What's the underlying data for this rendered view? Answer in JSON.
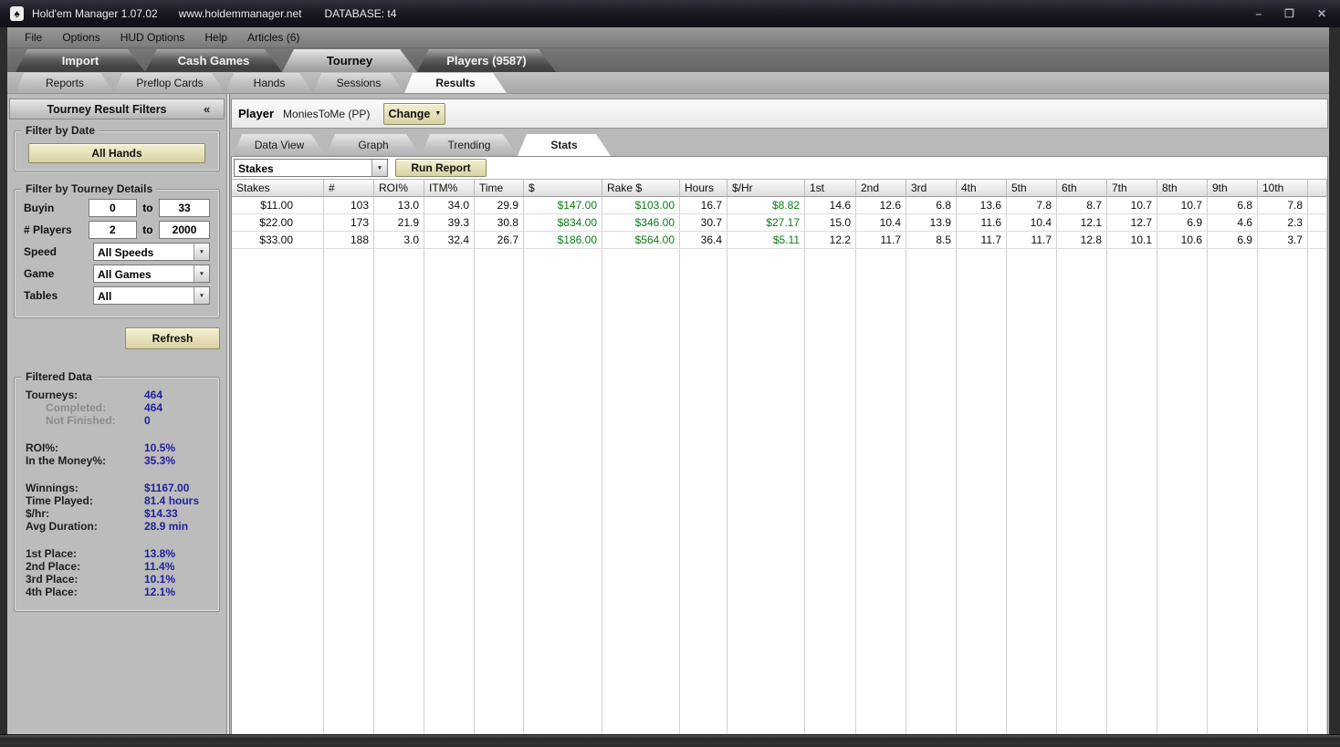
{
  "window": {
    "icon": "spade",
    "title": "Hold'em Manager 1.07.02",
    "url": "www.holdemmanager.net",
    "database": "DATABASE: t4",
    "controls": {
      "minimize": "–",
      "maximize": "❐",
      "close": "✕"
    }
  },
  "menu": {
    "items": [
      "File",
      "Options",
      "HUD Options",
      "Help",
      "Articles (6)"
    ]
  },
  "main_tabs": {
    "items": [
      {
        "label": "Import",
        "active": false
      },
      {
        "label": "Cash Games",
        "active": false
      },
      {
        "label": "Tourney",
        "active": true
      },
      {
        "label": "Players (9587)",
        "active": false
      }
    ]
  },
  "sub_tabs": {
    "items": [
      {
        "label": "Reports",
        "active": false
      },
      {
        "label": "Preflop Cards",
        "active": false
      },
      {
        "label": "Hands",
        "active": false
      },
      {
        "label": "Sessions",
        "active": false
      },
      {
        "label": "Results",
        "active": true
      }
    ]
  },
  "sidebar": {
    "title": "Tourney Result Filters",
    "collapse_icon": "«",
    "filter_by_date": {
      "label": "Filter by Date",
      "all_hands_button": "All Hands"
    },
    "filter_by_details": {
      "label": "Filter by Tourney Details",
      "buyin": {
        "label": "Buyin",
        "from": "0",
        "to_word": "to",
        "to": "33"
      },
      "players": {
        "label": "# Players",
        "from": "2",
        "to_word": "to",
        "to": "2000"
      },
      "speed": {
        "label": "Speed",
        "value": "All Speeds"
      },
      "game": {
        "label": "Game",
        "value": "All Games"
      },
      "tables": {
        "label": "Tables",
        "value": "All"
      }
    },
    "refresh_button": "Refresh",
    "filtered_data": {
      "label": "Filtered Data",
      "groups": [
        {
          "rows": [
            {
              "label": "Tourneys:",
              "value": "464"
            },
            {
              "label": "Completed:",
              "value": "464",
              "muted": true,
              "indent": true
            },
            {
              "label": "Not Finished:",
              "value": "0",
              "muted": true,
              "indent": true
            }
          ]
        },
        {
          "rows": [
            {
              "label": "ROI%:",
              "value": "10.5%"
            },
            {
              "label": "In the Money%:",
              "value": "35.3%"
            }
          ]
        },
        {
          "rows": [
            {
              "label": "Winnings:",
              "value": "$1167.00"
            },
            {
              "label": "Time Played:",
              "value": "81.4 hours"
            },
            {
              "label": "$/hr:",
              "value": "$14.33"
            },
            {
              "label": "Avg Duration:",
              "value": "28.9 min"
            }
          ]
        },
        {
          "rows": [
            {
              "label": "1st Place:",
              "value": "13.8%"
            },
            {
              "label": "2nd Place:",
              "value": "11.4%"
            },
            {
              "label": "3rd Place:",
              "value": "10.1%"
            },
            {
              "label": "4th Place:",
              "value": "12.1%"
            }
          ]
        }
      ]
    }
  },
  "player_bar": {
    "label": "Player",
    "name": "MoniesToMe (PP)",
    "change_button": "Change"
  },
  "view_tabs": {
    "items": [
      {
        "label": "Data View",
        "active": false
      },
      {
        "label": "Graph",
        "active": false
      },
      {
        "label": "Trending",
        "active": false
      },
      {
        "label": "Stats",
        "active": true
      }
    ]
  },
  "toolbar": {
    "report_select": "Stakes",
    "run_report_button": "Run Report"
  },
  "results_table": {
    "type": "table",
    "columns": [
      "Stakes",
      "#",
      "ROI%",
      "ITM%",
      "Time",
      "$",
      "Rake $",
      "Hours",
      "$/Hr",
      "1st",
      "2nd",
      "3rd",
      "4th",
      "5th",
      "6th",
      "7th",
      "8th",
      "9th",
      "10th"
    ],
    "money_columns": [
      5,
      6,
      8
    ],
    "rows": [
      [
        "$11.00",
        "103",
        "13.0",
        "34.0",
        "29.9",
        "$147.00",
        "$103.00",
        "16.7",
        "$8.82",
        "14.6",
        "12.6",
        "6.8",
        "13.6",
        "7.8",
        "8.7",
        "10.7",
        "10.7",
        "6.8",
        "7.8"
      ],
      [
        "$22.00",
        "173",
        "21.9",
        "39.3",
        "30.8",
        "$834.00",
        "$346.00",
        "30.7",
        "$27.17",
        "15.0",
        "10.4",
        "13.9",
        "11.6",
        "10.4",
        "12.1",
        "12.7",
        "6.9",
        "4.6",
        "2.3"
      ],
      [
        "$33.00",
        "188",
        "3.0",
        "32.4",
        "26.7",
        "$186.00",
        "$564.00",
        "36.4",
        "$5.11",
        "12.2",
        "11.7",
        "8.5",
        "11.7",
        "11.7",
        "12.8",
        "10.1",
        "10.6",
        "6.9",
        "3.7"
      ]
    ]
  }
}
